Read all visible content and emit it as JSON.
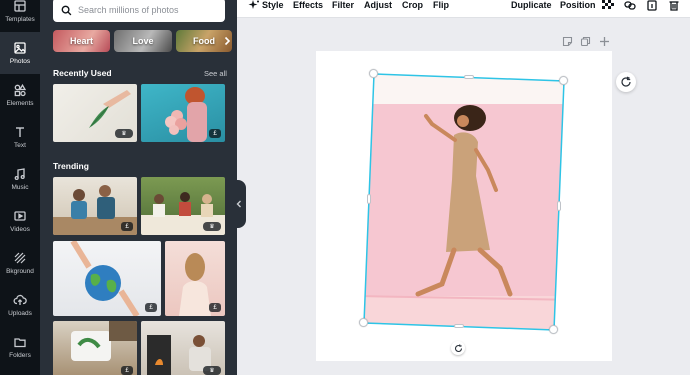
{
  "rail": {
    "items": [
      {
        "label": "Templates",
        "icon": "templates-icon"
      },
      {
        "label": "Photos",
        "icon": "photos-icon"
      },
      {
        "label": "Elements",
        "icon": "elements-icon"
      },
      {
        "label": "Text",
        "icon": "text-icon"
      },
      {
        "label": "Music",
        "icon": "music-icon"
      },
      {
        "label": "Videos",
        "icon": "videos-icon"
      },
      {
        "label": "Bkground",
        "icon": "background-icon"
      },
      {
        "label": "Uploads",
        "icon": "uploads-icon"
      },
      {
        "label": "Folders",
        "icon": "folders-icon"
      }
    ],
    "active": "Photos"
  },
  "panel": {
    "search": {
      "placeholder": "Search millions of photos",
      "value": ""
    },
    "chips": [
      {
        "label": "Heart"
      },
      {
        "label": "Love"
      },
      {
        "label": "Food"
      }
    ],
    "recently_used": {
      "title": "Recently Used",
      "see_all": "See all"
    },
    "trending": {
      "title": "Trending"
    }
  },
  "toolbar": {
    "style": "Style",
    "effects": "Effects",
    "filter": "Filter",
    "adjust": "Adjust",
    "crop": "Crop",
    "flip": "Flip",
    "duplicate": "Duplicate",
    "position": "Position"
  },
  "colors": {
    "rail_bg": "#0e1318",
    "panel_bg": "#293039",
    "canvas_bg": "#ebecf0",
    "selection": "#2ec4e6",
    "photo_wall": "#f4c4cf"
  }
}
